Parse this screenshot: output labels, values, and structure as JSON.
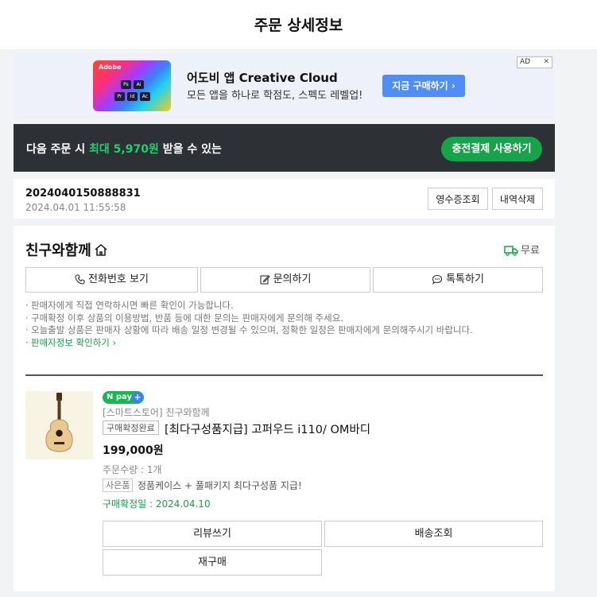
{
  "header": {
    "title": "주문 상세정보"
  },
  "ad": {
    "image_brand": "Adobe",
    "image_tiles": [
      "Ps",
      "Ai",
      "Pr",
      "Id",
      "Ac"
    ],
    "title": "어도비 앱 Creative Cloud",
    "subtitle": "모든 앱을 하나로 학점도, 스펙도 레벨업!",
    "cta": "지금 구매하기 ›",
    "badge": "AD",
    "close": "✕"
  },
  "promo": {
    "text_before": "다음 주문 시 ",
    "highlight": "최대 5,970원",
    "text_after": " 받을 수 있는",
    "button": "충전결제 사용하기"
  },
  "order": {
    "number": "2024040150888831",
    "date": "2024.04.01 11:55:58",
    "receipt_button": "영수증조회",
    "delete_button": "내역삭제"
  },
  "seller": {
    "name": "친구와함께",
    "delivery": "무료",
    "phone_button": "전화번호 보기",
    "inquiry_button": "문의하기",
    "talk_button": "톡톡하기",
    "notices": [
      "판매자에게 직접 연락하시면 빠른 확인이 가능합니다.",
      "구매확정 이후 상품의 이용방법, 반품 등에 대한 문의는 판매자에게 문의해 주세요.",
      "오늘출발 상품은 판매자 상황에 따라 배송 일정 변경될 수 있으며, 정확한 일정은 판매자에게 문의해주시기 바랍니다."
    ],
    "info_link": "판매자정보 확인하기 ›"
  },
  "product": {
    "pay_badge": "N pay",
    "store": "[스마트스토어] 친구와함께",
    "status": "구매확정완료",
    "name": "[최다구성품지급] 고퍼우드 i110/ OM바디",
    "price": "199,000원",
    "quantity": "주문수량 : 1개",
    "gift_badge": "사은품",
    "gift": "정품케이스 + 풀패키지 최다구성품 지급!",
    "confirm_date": "구매확정일 : 2024.04.10"
  },
  "actions": {
    "review": "리뷰쓰기",
    "tracking": "배송조회",
    "reorder": "재구매"
  },
  "colors": {
    "accent_green": "#16a34a",
    "promo_bg": "#2d3035",
    "ad_button": "#4f8ef7"
  }
}
